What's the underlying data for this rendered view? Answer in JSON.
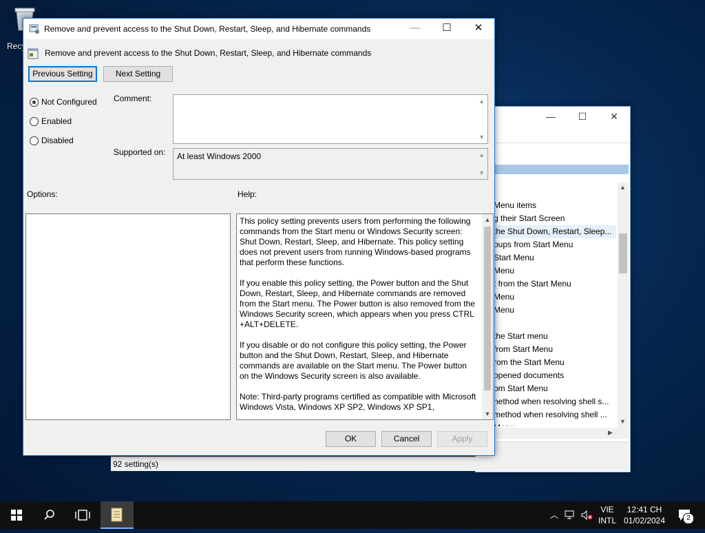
{
  "desktop": {
    "recycle_label": "Recy"
  },
  "background_window": {
    "items": [
      "Menu items",
      "g their Start Screen",
      "the Shut Down, Restart, Sleep...",
      "oups from Start Menu",
      "Start Menu",
      "Menu",
      "t from the Start Menu",
      "Menu",
      "Menu",
      "",
      "the Start menu",
      "from Start Menu",
      "rom the Start Menu",
      "opened documents",
      "om Start Menu",
      "nethod when resolving shell s...",
      "method when resolving shell ...",
      "Menu"
    ],
    "status": "92 setting(s)"
  },
  "dialog": {
    "title": "Remove and prevent access to the Shut Down, Restart, Sleep, and Hibernate commands",
    "header": "Remove and prevent access to the Shut Down, Restart, Sleep, and Hibernate commands",
    "prev_label": "Previous Setting",
    "next_label": "Next Setting",
    "radios": [
      "Not Configured",
      "Enabled",
      "Disabled"
    ],
    "selected_radio": "Not Configured",
    "comment_label": "Comment:",
    "comment_value": "",
    "supported_label": "Supported on:",
    "supported_value": "At least Windows 2000",
    "options_label": "Options:",
    "help_label": "Help:",
    "help_text": "This policy setting prevents users from performing the following commands from the Start menu or Windows Security screen: Shut Down, Restart, Sleep, and Hibernate. This policy setting does not prevent users from running Windows-based programs that perform these functions.\n\nIf you enable this policy setting, the Power button and the Shut Down, Restart, Sleep, and Hibernate commands are removed from the Start menu. The Power button is also removed from the Windows Security screen, which appears when you press CTRL +ALT+DELETE.\n\nIf you disable or do not configure this policy setting, the Power button and the Shut Down, Restart, Sleep, and Hibernate commands are available on the Start menu. The Power button on the Windows Security screen is also available.\n\nNote: Third-party programs certified as compatible with Microsoft Windows Vista, Windows XP SP2, Windows XP SP1,",
    "ok_label": "OK",
    "cancel_label": "Cancel",
    "apply_label": "Apply"
  },
  "taskbar": {
    "lang_top": "VIE",
    "lang_bottom": "INTL",
    "time": "12:41 CH",
    "date": "01/02/2024",
    "notification_count": "2"
  }
}
